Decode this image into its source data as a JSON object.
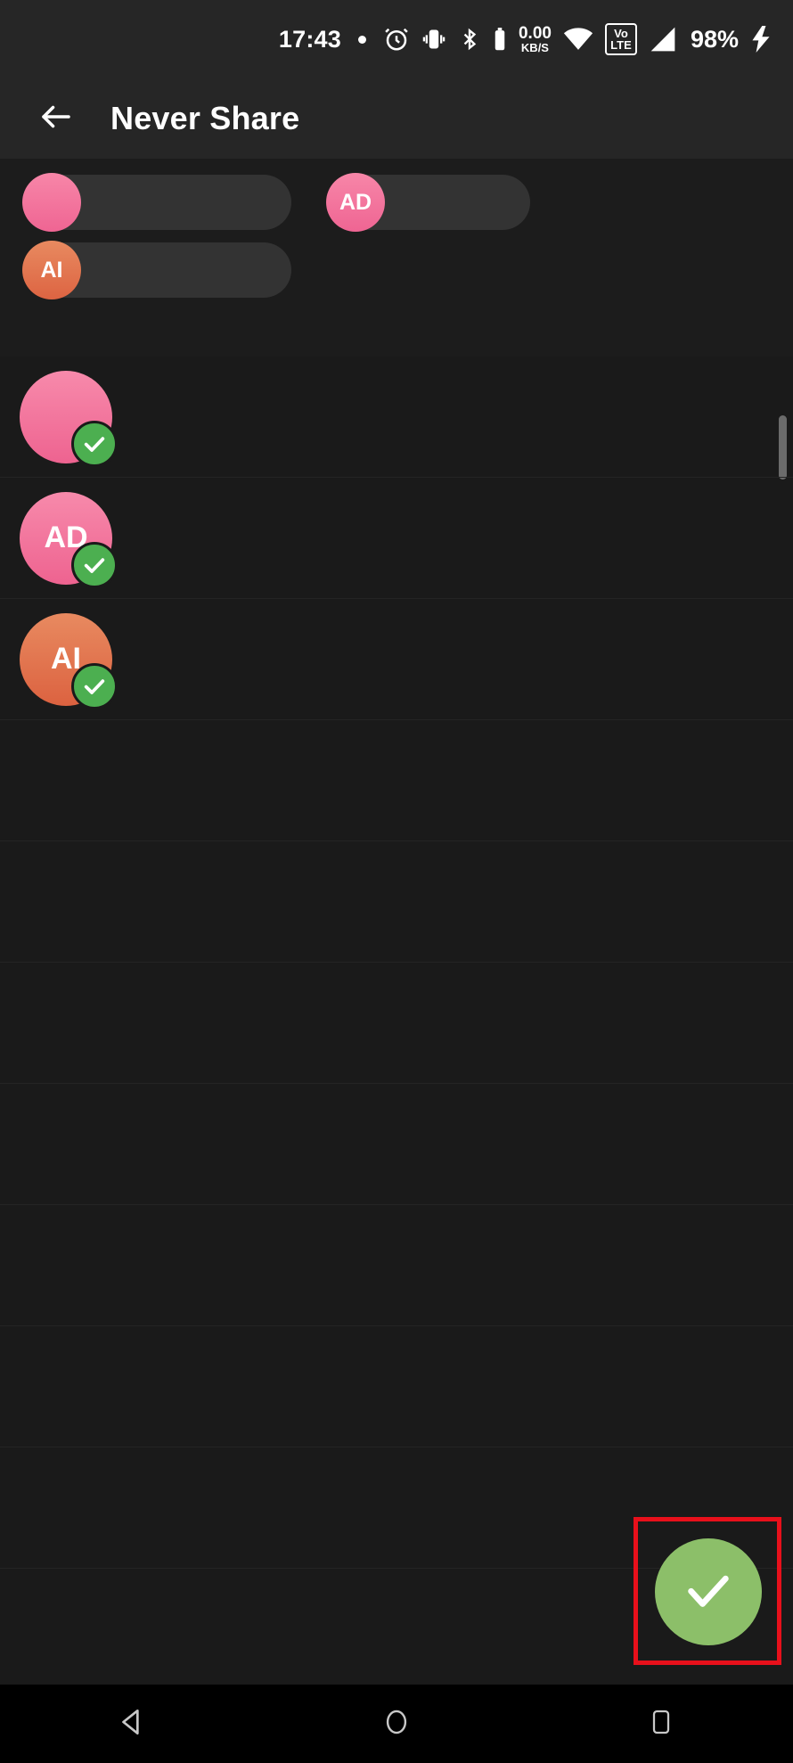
{
  "status_bar": {
    "time": "17:43",
    "network_speed_value": "0.00",
    "network_speed_unit": "KB/S",
    "volte_top": "Vo",
    "volte_bottom": "LTE",
    "battery": "98%",
    "icons": [
      "notification-dot-icon",
      "alarm-icon",
      "vibrate-icon",
      "bluetooth-icon",
      "battery-small-icon",
      "network-speed-icon",
      "wifi-icon",
      "volte-icon",
      "signal-icon",
      "charging-bolt-icon"
    ]
  },
  "app_bar": {
    "back_label": "back-arrow",
    "title": "Never Share"
  },
  "chips": {
    "rows": [
      [
        {
          "initials": "",
          "label": "",
          "color": "#f2729a"
        },
        {
          "initials": "AD",
          "label": "",
          "color": "#f2729a"
        }
      ],
      [
        {
          "initials": "AI",
          "label": "",
          "color": "#e0724b"
        }
      ]
    ]
  },
  "list": {
    "selected_badge": "check-icon",
    "items": [
      {
        "initials": "",
        "name": "",
        "subtitle": "",
        "color": "#f2729a",
        "selected": true
      },
      {
        "initials": "AD",
        "name": "",
        "subtitle": "",
        "color": "#f2729a",
        "selected": true
      },
      {
        "initials": "AI",
        "name": "",
        "subtitle": "",
        "color": "#e0724b",
        "selected": true
      },
      {
        "initials": "",
        "name": "",
        "subtitle": "",
        "color": "",
        "selected": false
      },
      {
        "initials": "",
        "name": "",
        "subtitle": "",
        "color": "",
        "selected": false
      },
      {
        "initials": "",
        "name": "",
        "subtitle": "",
        "color": "",
        "selected": false
      },
      {
        "initials": "",
        "name": "",
        "subtitle": "",
        "color": "",
        "selected": false
      },
      {
        "initials": "",
        "name": "",
        "subtitle": "",
        "color": "",
        "selected": false
      },
      {
        "initials": "",
        "name": "",
        "subtitle": "",
        "color": "",
        "selected": false
      },
      {
        "initials": "",
        "name": "",
        "subtitle": "",
        "color": "",
        "selected": false
      },
      {
        "initials": "",
        "name": "",
        "subtitle": "",
        "color": "",
        "selected": false
      }
    ]
  },
  "fab": {
    "icon": "check-icon",
    "color": "#8cbf69",
    "highlight_color": "#e8101b"
  },
  "nav_bar": {
    "back": "nav-back-icon",
    "home": "nav-home-icon",
    "recents": "nav-recents-icon"
  },
  "colors": {
    "accent_green": "#4caf50",
    "avatar_pink": "#f2729a",
    "avatar_orange": "#e0724b",
    "appbar_bg": "#262626",
    "content_bg": "#1a1a1a"
  }
}
